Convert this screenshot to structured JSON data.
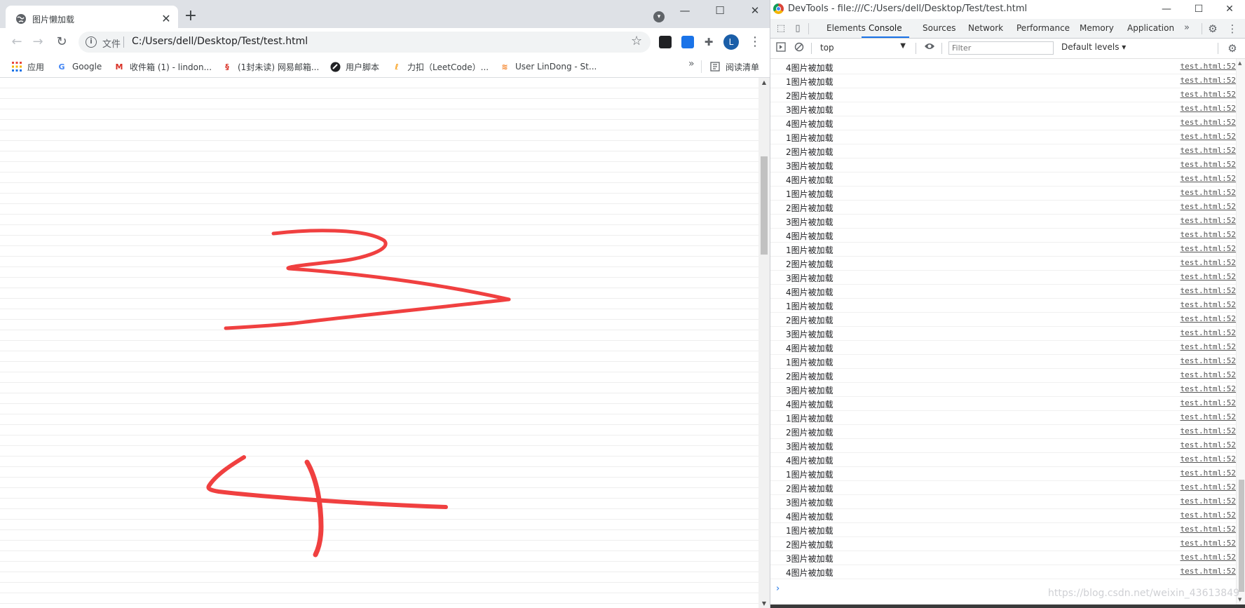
{
  "browser": {
    "tab_title": "图片懒加载",
    "tab_close": "✕",
    "new_tab": "+",
    "omnibox_chip": "文件",
    "url": "C:/Users/dell/Desktop/Test/test.html",
    "avatar_letter": "L",
    "bookmarks": [
      {
        "label": "应用",
        "icon": "apps-grid-icon"
      },
      {
        "label": "Google",
        "icon": "google-icon"
      },
      {
        "label": "收件箱 (1) - lindon...",
        "icon": "gmail-icon"
      },
      {
        "label": "(1封未读) 网易邮箱...",
        "icon": "netease-mail-icon"
      },
      {
        "label": "用户脚本",
        "icon": "userscript-icon"
      },
      {
        "label": "力扣（LeetCode）...",
        "icon": "leetcode-icon"
      },
      {
        "label": "User LinDong - St...",
        "icon": "stackoverflow-icon"
      }
    ],
    "bookmarks_overflow": "»",
    "reading_list": "阅读清单",
    "page": {
      "digits": [
        "3",
        "4"
      ],
      "ink_color": "#f04040"
    }
  },
  "devtools": {
    "title": "DevTools - file:///C:/Users/dell/Desktop/Test/test.html",
    "tabs": [
      "Elements",
      "Console",
      "Sources",
      "Network",
      "Performance",
      "Memory",
      "Application"
    ],
    "active_tab": "Console",
    "more_tabs": "»",
    "context": "top",
    "filter_placeholder": "Filter",
    "levels": "Default levels ▾",
    "logs": [
      {
        "msg": "4图片被加载",
        "src": "test.html:52"
      },
      {
        "msg": "1图片被加载",
        "src": "test.html:52"
      },
      {
        "msg": "2图片被加载",
        "src": "test.html:52"
      },
      {
        "msg": "3图片被加载",
        "src": "test.html:52"
      },
      {
        "msg": "4图片被加载",
        "src": "test.html:52"
      },
      {
        "msg": "1图片被加载",
        "src": "test.html:52"
      },
      {
        "msg": "2图片被加载",
        "src": "test.html:52"
      },
      {
        "msg": "3图片被加载",
        "src": "test.html:52"
      },
      {
        "msg": "4图片被加载",
        "src": "test.html:52"
      },
      {
        "msg": "1图片被加载",
        "src": "test.html:52"
      },
      {
        "msg": "2图片被加载",
        "src": "test.html:52"
      },
      {
        "msg": "3图片被加载",
        "src": "test.html:52"
      },
      {
        "msg": "4图片被加载",
        "src": "test.html:52"
      },
      {
        "msg": "1图片被加载",
        "src": "test.html:52"
      },
      {
        "msg": "2图片被加载",
        "src": "test.html:52"
      },
      {
        "msg": "3图片被加载",
        "src": "test.html:52"
      },
      {
        "msg": "4图片被加载",
        "src": "test.html:52"
      },
      {
        "msg": "1图片被加载",
        "src": "test.html:52"
      },
      {
        "msg": "2图片被加载",
        "src": "test.html:52"
      },
      {
        "msg": "3图片被加载",
        "src": "test.html:52"
      },
      {
        "msg": "4图片被加载",
        "src": "test.html:52"
      },
      {
        "msg": "1图片被加载",
        "src": "test.html:52"
      },
      {
        "msg": "2图片被加载",
        "src": "test.html:52"
      },
      {
        "msg": "3图片被加载",
        "src": "test.html:52"
      },
      {
        "msg": "4图片被加载",
        "src": "test.html:52"
      },
      {
        "msg": "1图片被加载",
        "src": "test.html:52"
      },
      {
        "msg": "2图片被加载",
        "src": "test.html:52"
      },
      {
        "msg": "3图片被加载",
        "src": "test.html:52"
      },
      {
        "msg": "4图片被加载",
        "src": "test.html:52"
      },
      {
        "msg": "1图片被加载",
        "src": "test.html:52"
      },
      {
        "msg": "2图片被加载",
        "src": "test.html:52"
      },
      {
        "msg": "3图片被加载",
        "src": "test.html:52"
      },
      {
        "msg": "4图片被加载",
        "src": "test.html:52"
      },
      {
        "msg": "1图片被加载",
        "src": "test.html:52"
      },
      {
        "msg": "2图片被加载",
        "src": "test.html:52"
      },
      {
        "msg": "3图片被加载",
        "src": "test.html:52"
      },
      {
        "msg": "4图片被加载",
        "src": "test.html:52"
      }
    ],
    "prompt": "›",
    "watermark": "https://blog.csdn.net/weixin_43613849"
  }
}
